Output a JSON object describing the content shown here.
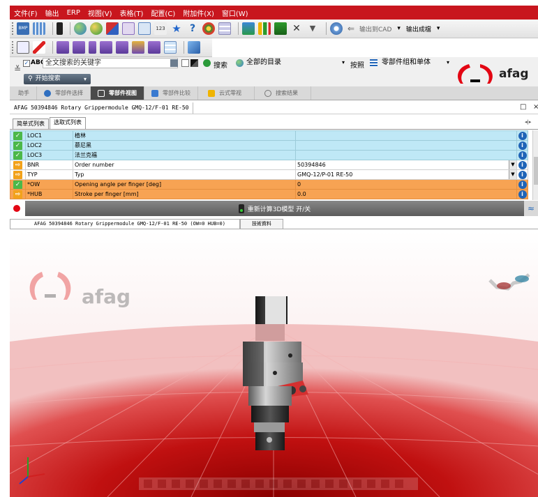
{
  "menu": [
    "文件(F)",
    "输出",
    "ERP",
    "视图(V)",
    "表格(T)",
    "配置(C)",
    "附加件(X)",
    "窗口(W)"
  ],
  "toolbar": {
    "export_cad_label": "输出到CAD",
    "export_drawing_label": "输出成檔"
  },
  "search": {
    "abc_label": "ABC",
    "placeholder": "全文搜索的关键字",
    "search_label": "搜索",
    "scope_value": "全部的目录",
    "sort_label": "按照",
    "sort_value": "零部件组和单体",
    "start_button": "开始搜索"
  },
  "logo": {
    "text": "afag"
  },
  "tabs": [
    "助手",
    "零部件选择",
    "零部件视图",
    "零部件比较",
    "云式零视",
    "搜索结果"
  ],
  "active_tab_index": 2,
  "part_title": "AFAG 50394846 Rotary Grippermodule GMQ-12/F-01 RE-50",
  "window_controls": {
    "restore": "□",
    "close": "×"
  },
  "subtabs": [
    "简单式列表",
    "选取式列表"
  ],
  "active_subtab_index": 1,
  "table": {
    "rows": [
      {
        "status": "ok",
        "status_glyph": "✓",
        "name": "LOC1",
        "desc": "植林",
        "value": "",
        "style": "blue"
      },
      {
        "status": "ok",
        "status_glyph": "✓",
        "name": "LOC2",
        "desc": "慕尼黑",
        "value": "",
        "style": "blue"
      },
      {
        "status": "ok",
        "status_glyph": "✓",
        "name": "LOC3",
        "desc": "法兰克福",
        "value": "",
        "style": "blue"
      },
      {
        "status": "warn",
        "status_glyph": "⇨",
        "name": "BNR",
        "desc": "Order number",
        "value": "50394846",
        "style": "white",
        "dropdown": true
      },
      {
        "status": "warn",
        "status_glyph": "⇨",
        "name": "TYP",
        "desc": "Typ",
        "value": "GMQ-12/P-01 RE-50",
        "style": "white",
        "dropdown": true
      },
      {
        "status": "ok",
        "status_glyph": "✓",
        "name": "*OW",
        "desc": "Opening angle per finger [deg]",
        "value": "0",
        "style": "orange"
      },
      {
        "status": "warn",
        "status_glyph": "⇨",
        "name": "*HUB",
        "desc": "Stroke per finger [mm]",
        "value": "0.0",
        "style": "orange"
      }
    ],
    "info_glyph": "i",
    "dropdown_glyph": "▼"
  },
  "regen": {
    "label": "重新计算3D模型 开/关",
    "collapse_glyph": "≈"
  },
  "view": {
    "caption": "AFAG 50394846 Rotary Grippermodule GMQ-12/F-01 RE-50 (OW=0 HUB=0)",
    "tech_tab": "技術資料"
  },
  "colors": {
    "menubar_red": "#c8161e",
    "row_blue": "#bfe8f6",
    "row_orange": "#f7a353",
    "status_ok": "#4cb849",
    "status_warn": "#f2a21b",
    "info_blue": "#1f64b7",
    "floor_red": "#c01010",
    "logo_red": "#e30613"
  },
  "icons": [
    "bmp-icon",
    "grid-icon",
    "traffic-light-icon",
    "globe-icon",
    "puzzle-icon",
    "star-icon",
    "help-icon",
    "table-icon",
    "chart-icon",
    "gear-icon",
    "3d-glasses-icon",
    "axis-icon"
  ]
}
